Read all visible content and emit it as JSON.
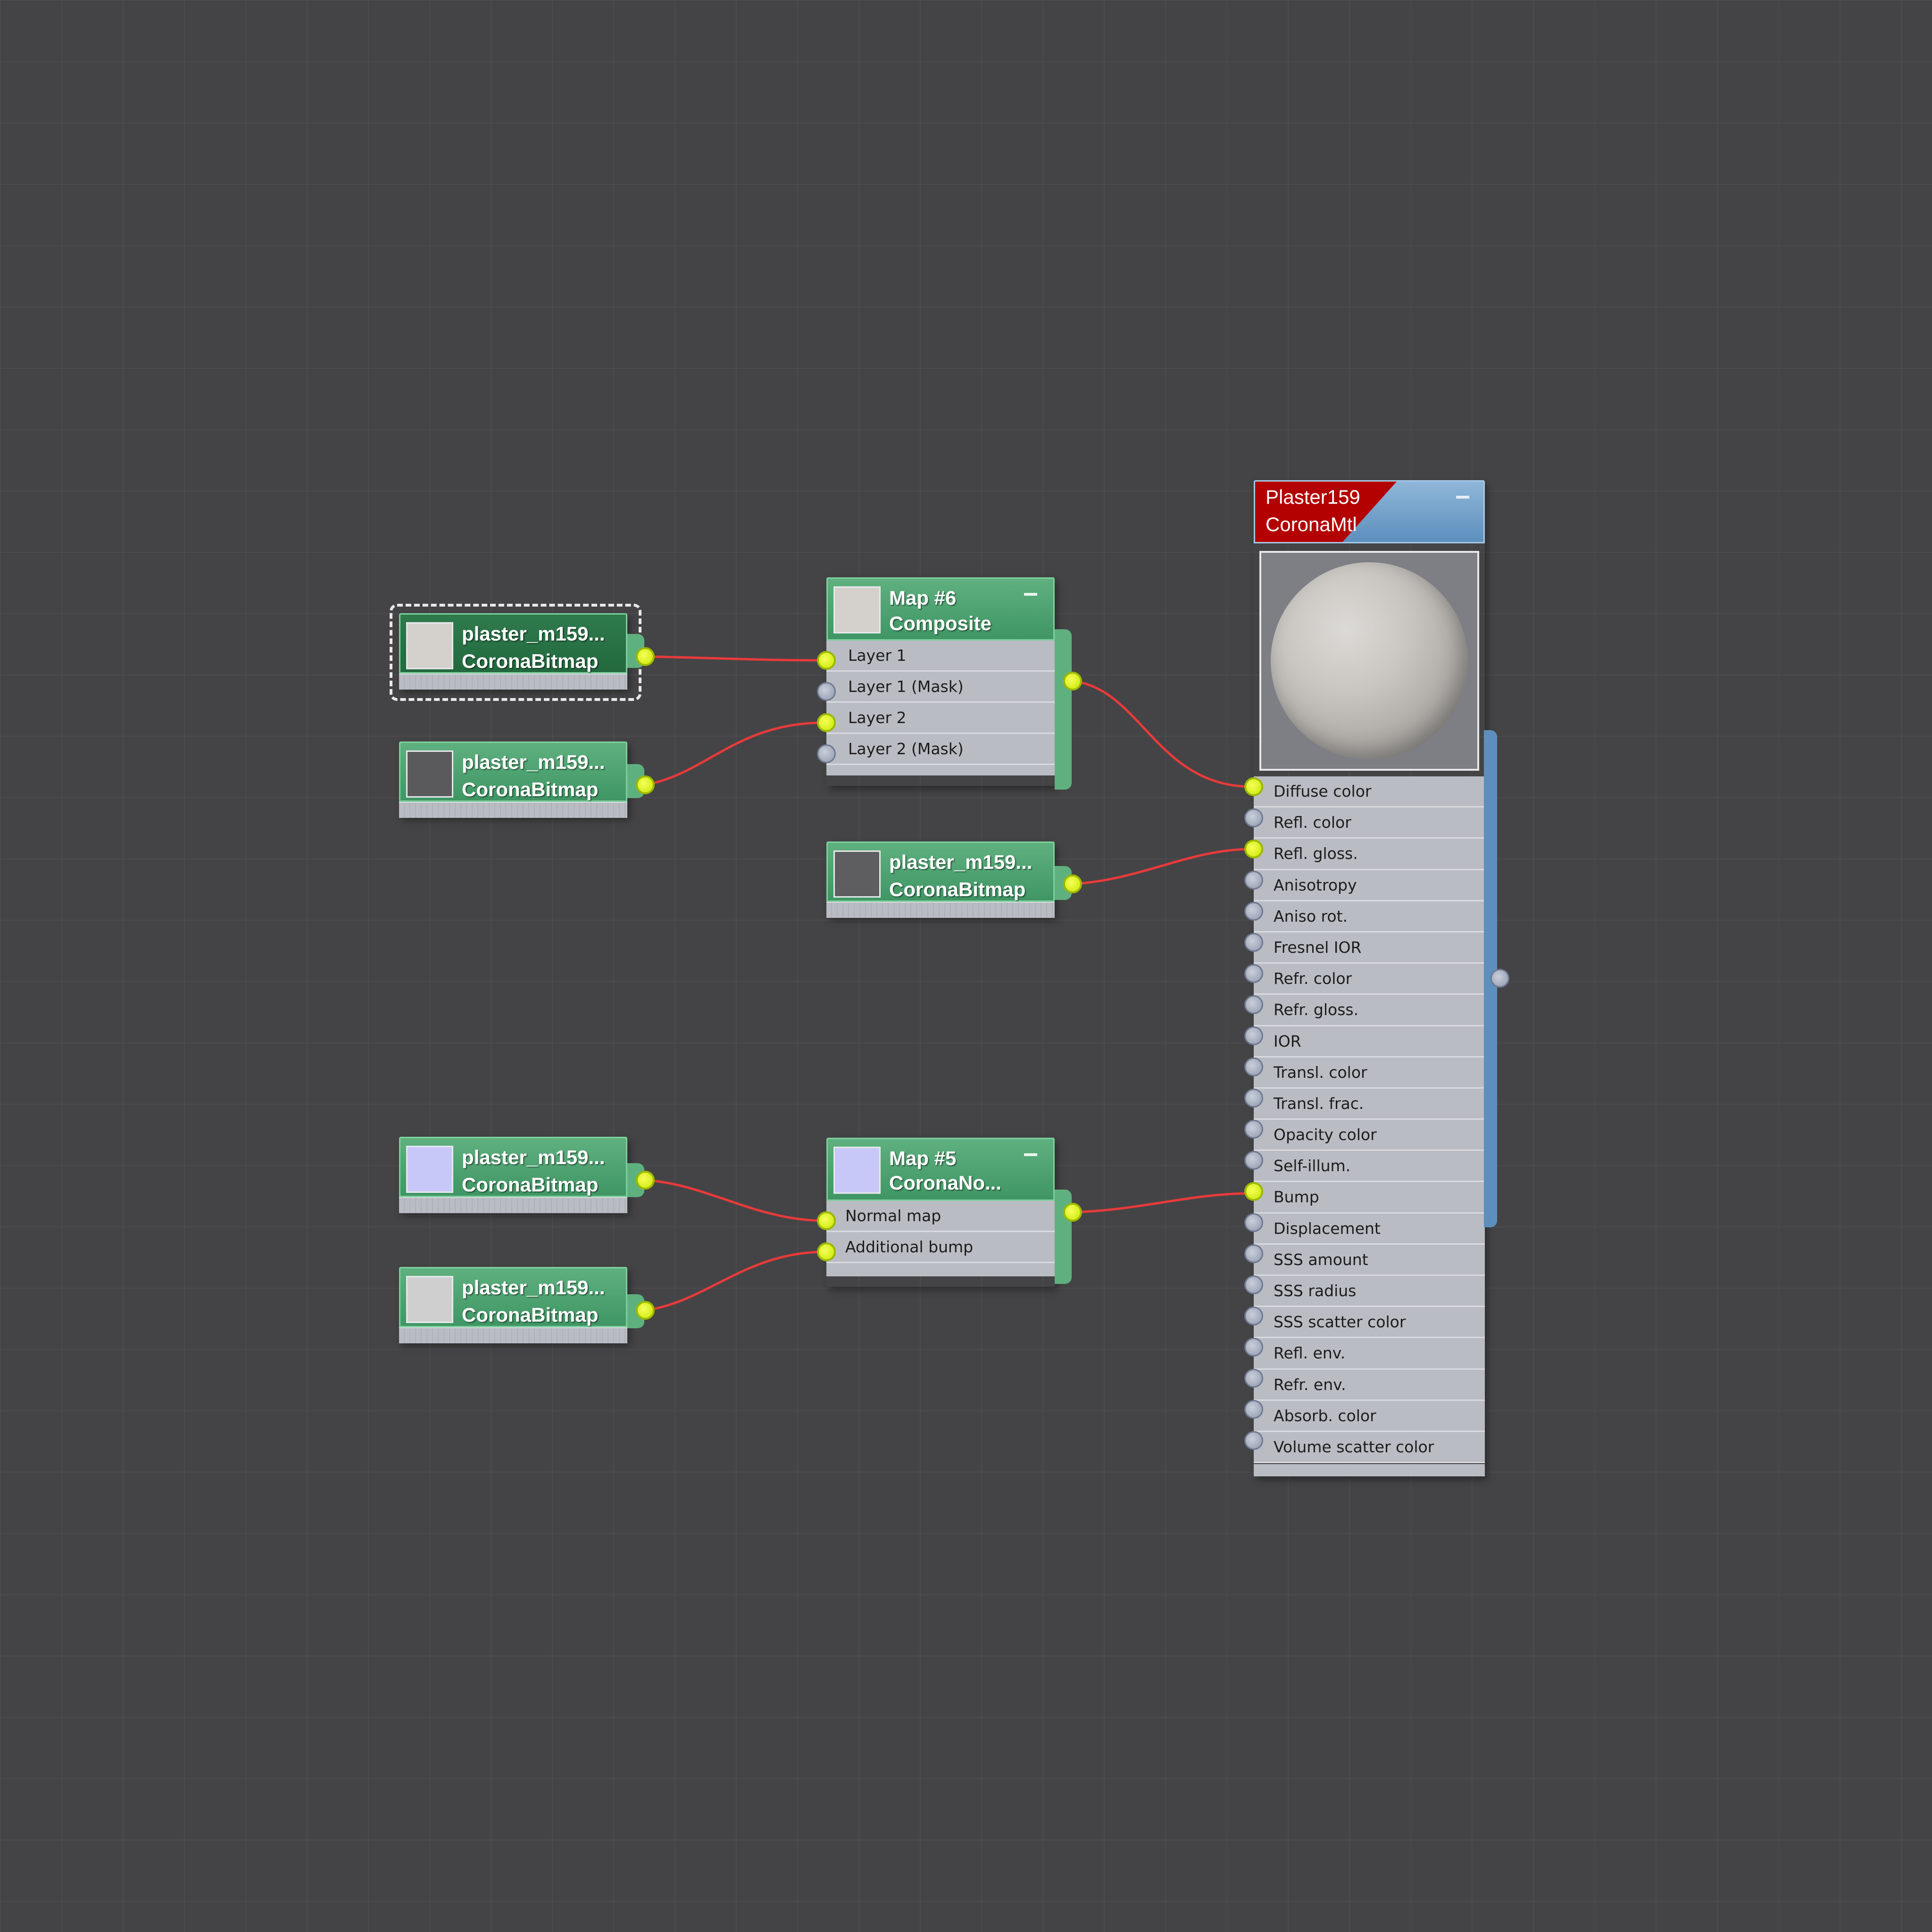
{
  "nodes": {
    "bitmap_1": {
      "title": "plaster_m159...",
      "type": "CoronaBitmap",
      "thumb_color": "#d4d0cb"
    },
    "bitmap_2": {
      "title": "plaster_m159...",
      "type": "CoronaBitmap",
      "thumb_color": "#5a5a5c"
    },
    "bitmap_3": {
      "title": "plaster_m159...",
      "type": "CoronaBitmap",
      "thumb_color": "#5e5e60"
    },
    "bitmap_4": {
      "title": "plaster_m159...",
      "type": "CoronaBitmap",
      "thumb_color": "#c8c8f8"
    },
    "bitmap_5": {
      "title": "plaster_m159...",
      "type": "CoronaBitmap",
      "thumb_color": "#cfcfcf"
    },
    "map6": {
      "title": "Map #6",
      "type": "Composite",
      "thumb_color": "#d4d0cb",
      "slots": [
        "Layer 1",
        "Layer 1 (Mask)",
        "Layer 2",
        "Layer 2 (Mask)"
      ]
    },
    "map5": {
      "title": "Map #5",
      "type": "CoronaNo...",
      "thumb_color": "#c8c8f8",
      "slots": [
        "Normal map",
        "Additional bump"
      ]
    },
    "material": {
      "title": "Plaster159",
      "type": "CoronaMtl",
      "slots": [
        "Diffuse color",
        "Refl. color",
        "Refl. gloss.",
        "Anisotropy",
        "Aniso rot.",
        "Fresnel IOR",
        "Refr. color",
        "Refr. gloss.",
        "IOR",
        "Transl. color",
        "Transl. frac.",
        "Opacity color",
        "Self-illum.",
        "Bump",
        "Displacement",
        "SSS amount",
        "SSS radius",
        "SSS scatter color",
        "Refl. env.",
        "Refr. env.",
        "Absorb. color",
        "Volume scatter color"
      ]
    }
  },
  "colors": {
    "wire": "#e83a3a",
    "port_connected": "#d4f000",
    "port_empty": "#8f99ac",
    "map_header": "#4fa370",
    "material_header": "#6a9ac6",
    "material_flag": "#b30000"
  }
}
